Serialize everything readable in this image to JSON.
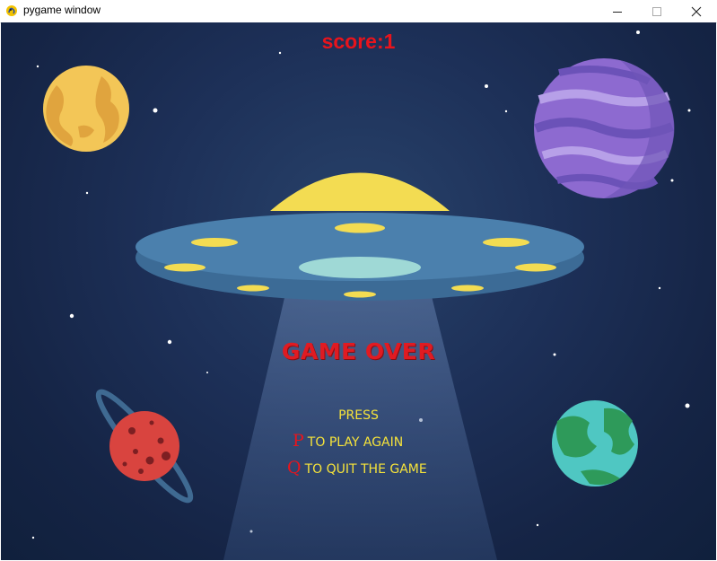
{
  "window": {
    "title": "pygame window",
    "icon": "pygame-snake-icon",
    "controls": [
      "minimize-icon",
      "maximize-icon",
      "close-icon"
    ]
  },
  "game": {
    "score_text": "score:1",
    "game_over_text": "GAME OVER",
    "press_text": "PRESS",
    "options": [
      {
        "key": "P",
        "text": "TO PLAY AGAIN"
      },
      {
        "key": "Q",
        "text": "TO QUIT THE GAME"
      }
    ]
  },
  "colors": {
    "score": "#e8141c",
    "game_over": "#e01b22",
    "instructions": "#f6e33a",
    "key_letters": "#e8141c",
    "background": "#1d3058"
  }
}
